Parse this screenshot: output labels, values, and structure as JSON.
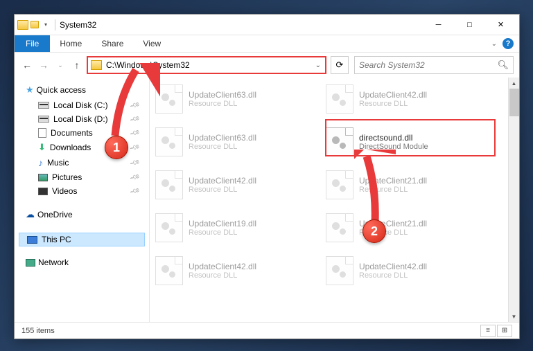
{
  "window": {
    "title": "System32"
  },
  "ribbon": {
    "file": "File",
    "home": "Home",
    "share": "Share",
    "view": "View"
  },
  "address": {
    "path": "C:\\Windows\\System32"
  },
  "search": {
    "placeholder": "Search System32"
  },
  "sidebar": {
    "quick_access": "Quick access",
    "items": [
      {
        "label": "Local Disk (C:)"
      },
      {
        "label": "Local Disk (D:)"
      },
      {
        "label": "Documents"
      },
      {
        "label": "Downloads"
      },
      {
        "label": "Music"
      },
      {
        "label": "Pictures"
      },
      {
        "label": "Videos"
      }
    ],
    "onedrive": "OneDrive",
    "thispc": "This PC",
    "network": "Network"
  },
  "files": [
    {
      "name": "UpdateClient63.dll",
      "desc": "Resource DLL"
    },
    {
      "name": "UpdateClient42.dll",
      "desc": "Resource DLL"
    },
    {
      "name": "UpdateClient63.dll",
      "desc": "Resource DLL"
    },
    {
      "name": "directsound.dll",
      "desc": "DirectSound Module"
    },
    {
      "name": "UpdateClient42.dll",
      "desc": "Resource DLL"
    },
    {
      "name": "UpdateClient21.dll",
      "desc": "Resource DLL"
    },
    {
      "name": "UpdateClient19.dll",
      "desc": "Resource DLL"
    },
    {
      "name": "UpdateClient21.dll",
      "desc": "Resource DLL"
    },
    {
      "name": "UpdateClient42.dll",
      "desc": "Resource DLL"
    },
    {
      "name": "UpdateClient42.dll",
      "desc": "Resource DLL"
    }
  ],
  "status": {
    "count": "155 items"
  },
  "annotations": {
    "badge1": "1",
    "badge2": "2"
  }
}
